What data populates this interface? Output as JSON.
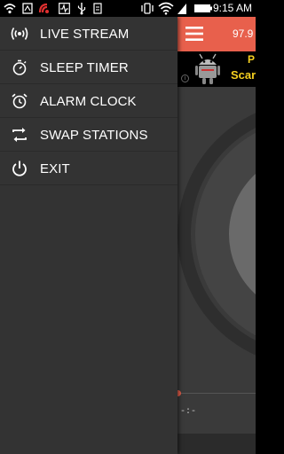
{
  "status_bar": {
    "time": "9:15 AM",
    "battery_icon": "battery-icon",
    "wifi_icon": "wifi-icon"
  },
  "drawer": {
    "items": [
      {
        "label": "LIVE STREAM",
        "icon": "radio-signal-icon"
      },
      {
        "label": "SLEEP TIMER",
        "icon": "stopwatch-icon"
      },
      {
        "label": "ALARM CLOCK",
        "icon": "alarm-clock-icon"
      },
      {
        "label": "SWAP STATIONS",
        "icon": "swap-arrows-icon"
      },
      {
        "label": "EXIT",
        "icon": "power-icon"
      }
    ]
  },
  "app": {
    "title": "97.9",
    "ad_line_1": "P",
    "ad_line_2": "Scar",
    "playback_time": "-:-",
    "accent_color": "#e8604c"
  },
  "colors": {
    "drawer_bg": "#333333",
    "toolbar": "#e8604c",
    "ad_text": "#f5d020"
  }
}
